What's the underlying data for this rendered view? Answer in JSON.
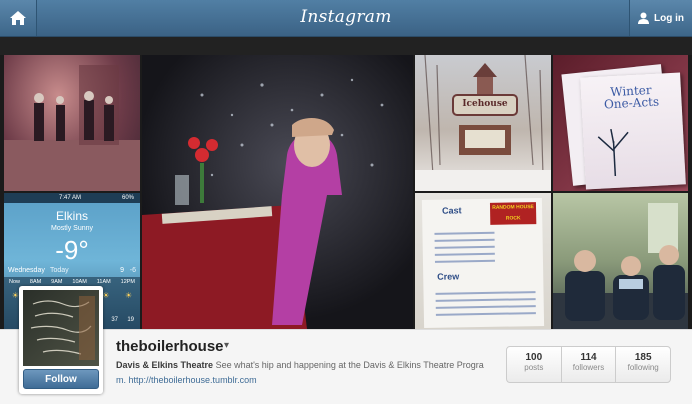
{
  "header": {
    "logo": "Instagram",
    "login_label": "Log in"
  },
  "tiles": {
    "weather": {
      "status_time": "7:47 AM",
      "battery": "60%",
      "city": "Elkins",
      "condition": "Mostly Sunny",
      "temp": "-9°",
      "day": "Wednesday",
      "today": "Today",
      "hi": "9",
      "lo": "-6",
      "hours": [
        "Now",
        "8AM",
        "9AM",
        "10AM",
        "11AM",
        "12PM"
      ],
      "bottom_temps": [
        "37",
        "19"
      ]
    },
    "icehouse": {
      "sign": "Icehouse"
    },
    "poster": {
      "text": [
        "Winter",
        "One-Acts"
      ]
    },
    "cast": {
      "title": "Cast",
      "crew": "Crew",
      "logo": "RANDOM HOUSE ROCK"
    }
  },
  "profile": {
    "username": "theboilerhouse",
    "bio_name": "Davis & Elkins Theatre",
    "bio_text": "See what's hip and happening at the Davis & Elkins Theatre Progra",
    "link": "m. http://theboilerhouse.tumblr.com",
    "follow_label": "Follow",
    "stats": [
      {
        "count": "100",
        "label": "posts"
      },
      {
        "count": "114",
        "label": "followers"
      },
      {
        "count": "185",
        "label": "following"
      }
    ]
  }
}
